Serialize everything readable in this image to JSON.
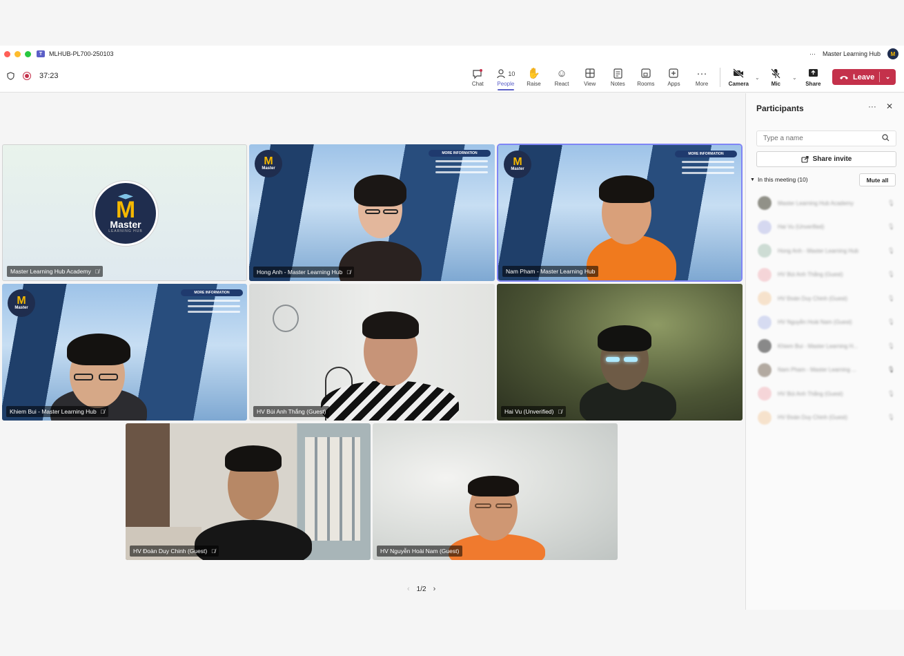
{
  "window": {
    "title": "MLHUB-PL700-250103",
    "org_name": "Master Learning Hub",
    "more_label": "···",
    "org_badge": "M"
  },
  "meeting": {
    "timer": "37:23"
  },
  "toolbar": {
    "chat": "Chat",
    "people": "People",
    "people_count": "10",
    "raise": "Raise",
    "react": "React",
    "view": "View",
    "notes": "Notes",
    "rooms": "Rooms",
    "apps": "Apps",
    "more": "More",
    "camera": "Camera",
    "mic": "Mic",
    "share": "Share",
    "leave": "Leave"
  },
  "tiles": {
    "t1": "Master Learning Hub Academy",
    "t2": "Hong Anh - Master Learning Hub",
    "t3": "Nam Pham - Master Learning Hub",
    "t4": "Khiem Bui - Master Learning Hub",
    "t5": "HV Bùi Anh Thắng (Guest)",
    "t6": "Hai Vu (Unverified)",
    "t7": "HV Đoàn Duy Chinh (Guest)",
    "t8": "HV Nguyễn Hoài Nam (Guest)"
  },
  "logo": {
    "m": "M",
    "word": "Master",
    "sub": "LEARNING HUB",
    "info_head": "MORE INFORMATION"
  },
  "pager": {
    "text": "1/2"
  },
  "panel": {
    "title": "Participants",
    "search_placeholder": "Type a name",
    "share_invite": "Share invite",
    "section": "In this meeting (10)",
    "mute_all": "Mute all",
    "participants": [
      "Master Learning Hub Academy",
      "Hai Vu (Unverified)",
      "Hong Anh - Master Learning Hub",
      "HV Bùi Anh Thắng (Guest)",
      "HV Đoàn Duy Chinh (Guest)",
      "HV Nguyễn Hoài Nam (Guest)",
      "Khiem Bui - Master Learning H...",
      "Nam Pham - Master Learning ...",
      "HV Bùi Anh Thắng (Guest)",
      "HV Đoàn Duy Chinh (Guest)"
    ]
  },
  "colors": {
    "accent": "#5b5fc7",
    "leave": "#c4314b"
  }
}
